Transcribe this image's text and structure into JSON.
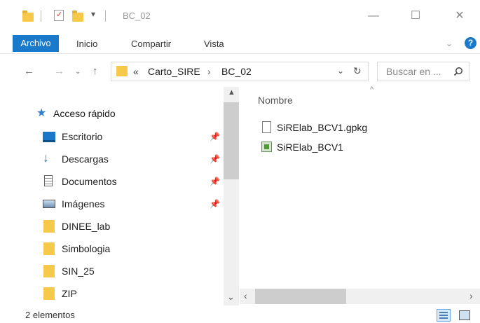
{
  "window": {
    "title": "BC_02",
    "minimize_icon": "minimize-icon",
    "maximize_icon": "maximize-icon",
    "close_icon": "close-icon"
  },
  "ribbon": {
    "tabs": [
      "Archivo",
      "Inicio",
      "Compartir",
      "Vista"
    ],
    "active_color": "#1979ca"
  },
  "address": {
    "overflow": "«",
    "crumbs": [
      "Carto_SIRE",
      "BC_02"
    ],
    "separator": "›"
  },
  "search": {
    "placeholder": "Buscar en ..."
  },
  "nav": {
    "quick_access_label": "Acceso rápido",
    "items": [
      {
        "label": "Escritorio",
        "icon": "desktop-icon",
        "pinned": true
      },
      {
        "label": "Descargas",
        "icon": "downloads-icon",
        "pinned": true
      },
      {
        "label": "Documentos",
        "icon": "documents-icon",
        "pinned": true
      },
      {
        "label": "Imágenes",
        "icon": "pictures-icon",
        "pinned": true
      },
      {
        "label": "DINEE_lab",
        "icon": "folder-icon",
        "pinned": false
      },
      {
        "label": "Simbologia",
        "icon": "folder-icon",
        "pinned": false
      },
      {
        "label": "SIN_25",
        "icon": "folder-icon",
        "pinned": false
      },
      {
        "label": "ZIP",
        "icon": "folder-icon",
        "pinned": false
      }
    ]
  },
  "content": {
    "column_header": "Nombre",
    "files": [
      {
        "name": "SiRElab_BCV1.gpkg",
        "icon": "file-icon"
      },
      {
        "name": "SiRElab_BCV1",
        "icon": "qgis-project-icon"
      }
    ]
  },
  "status": {
    "count": "2 elementos"
  }
}
